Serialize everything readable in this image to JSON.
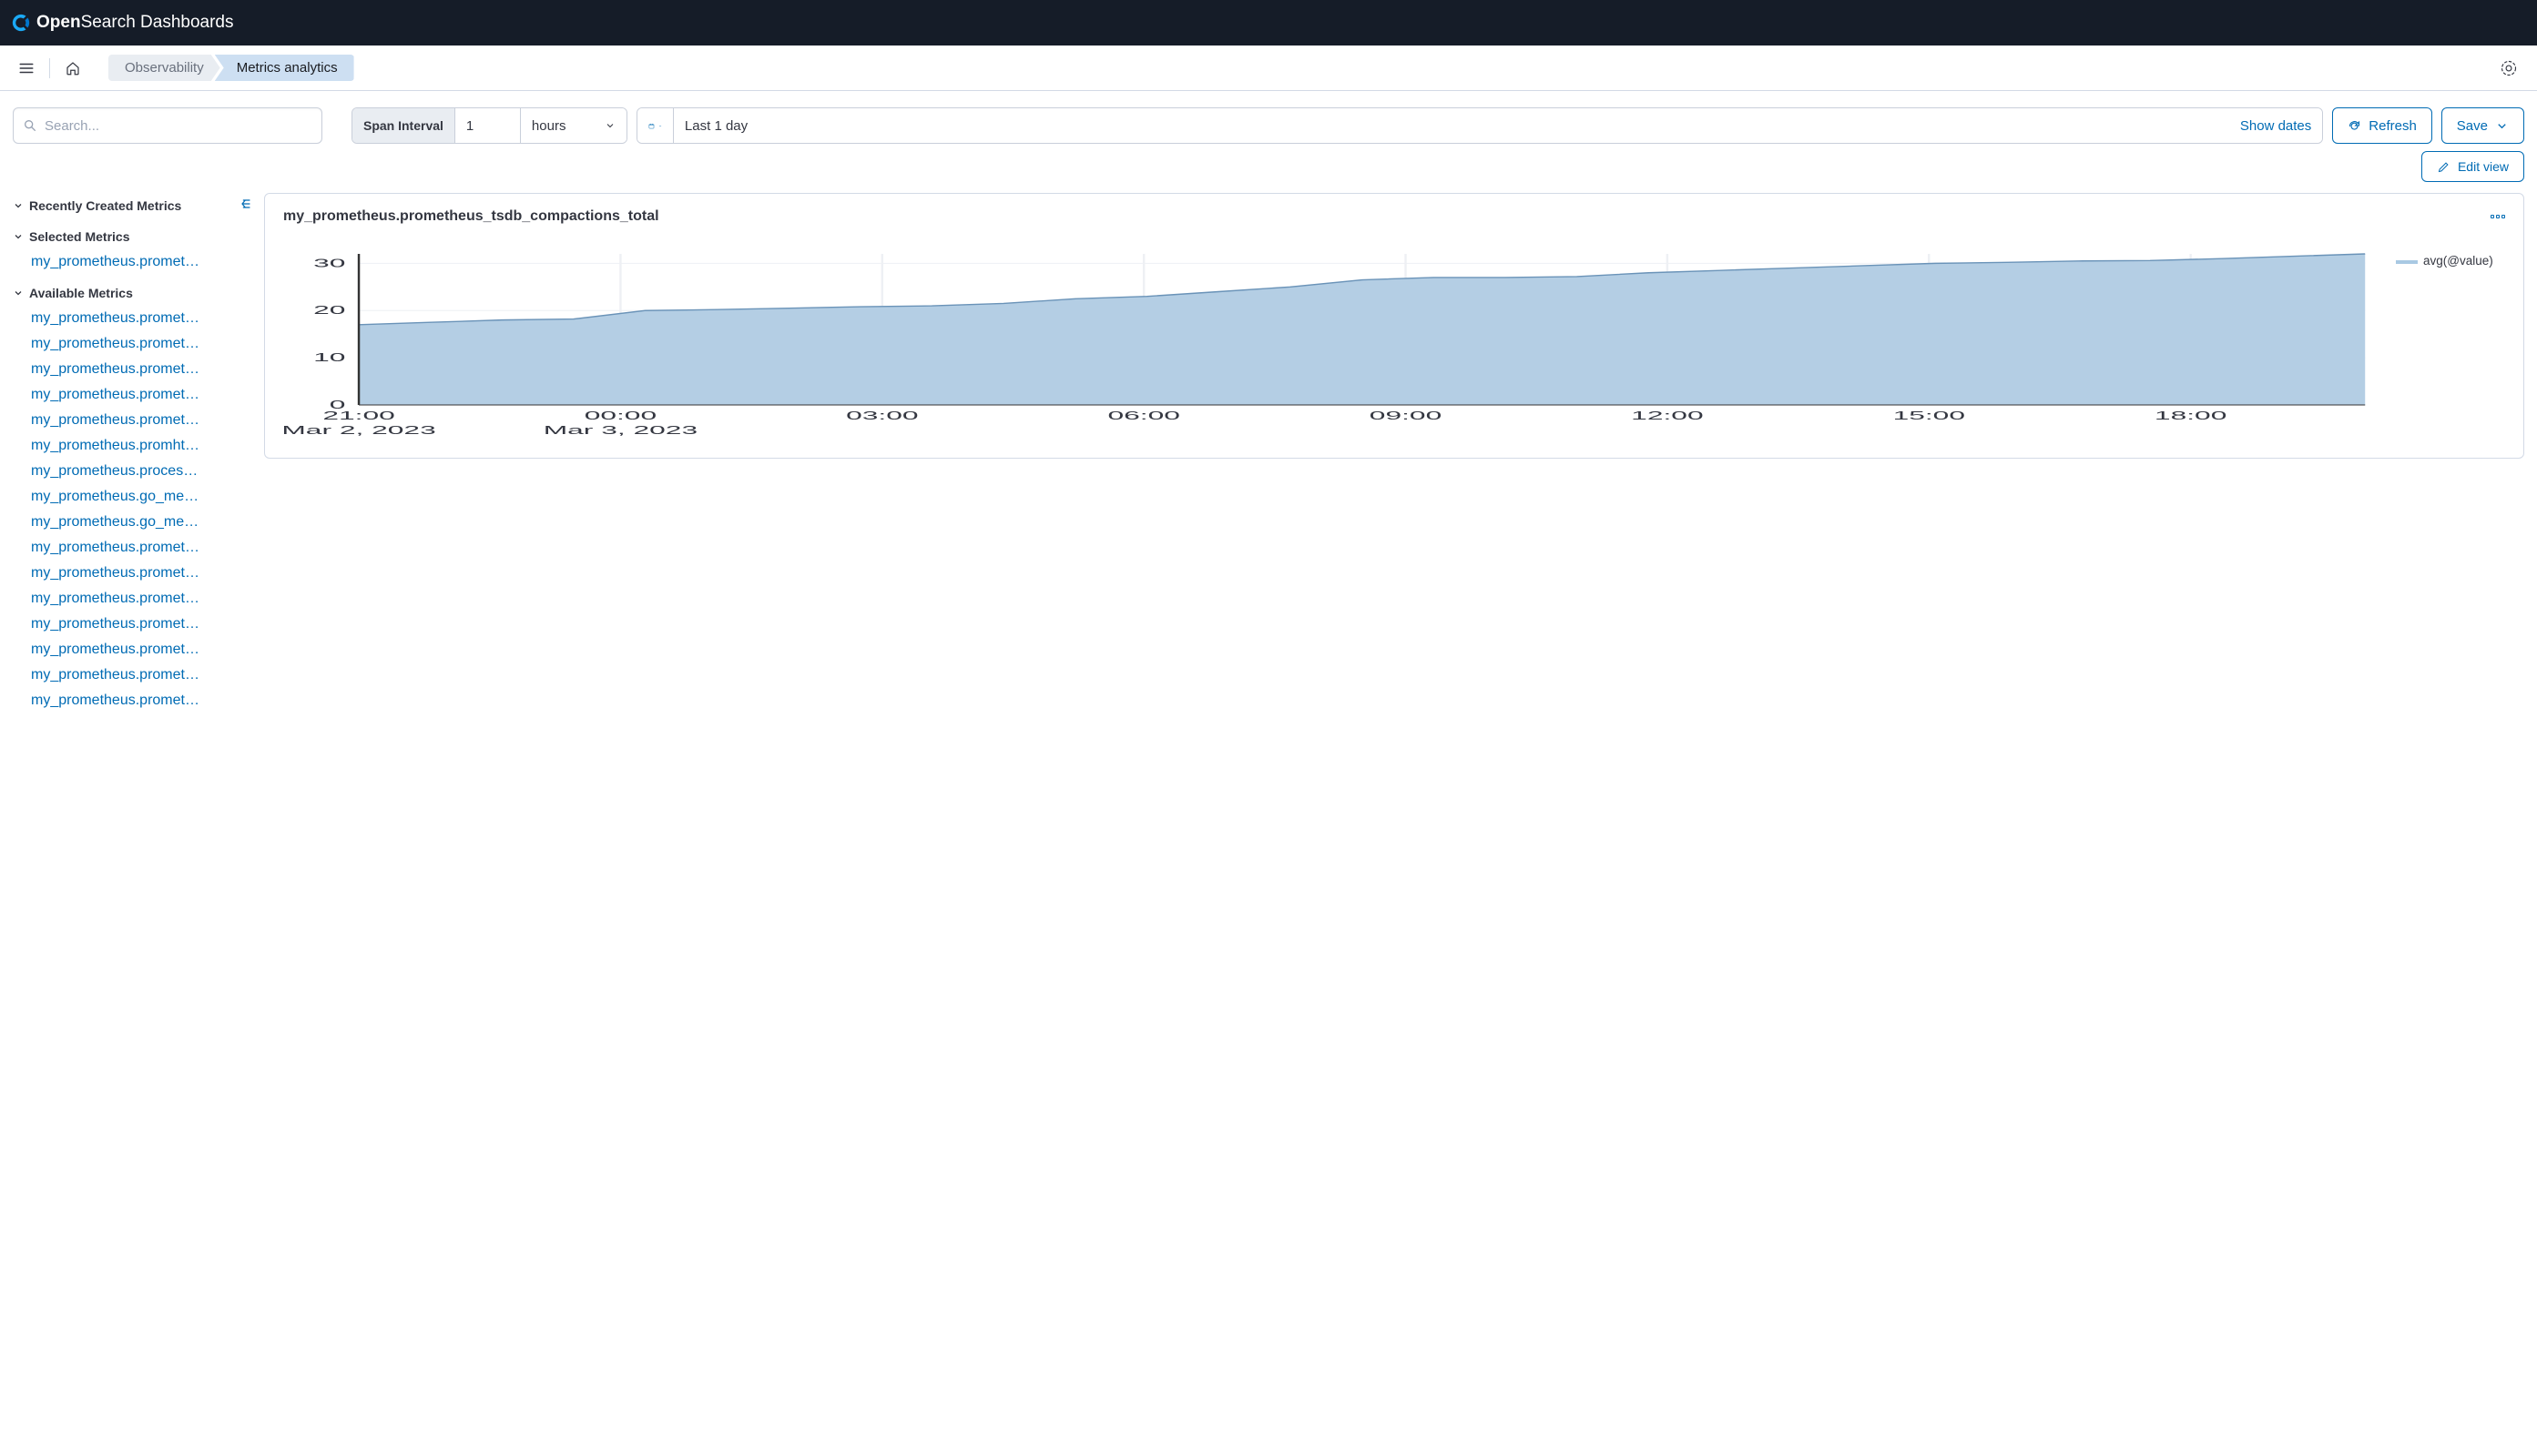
{
  "header": {
    "product_open": "Open",
    "product_search": "Search",
    "product_dash": "Dashboards"
  },
  "breadcrumb": {
    "observability": "Observability",
    "current": "Metrics analytics"
  },
  "toolbar": {
    "search_placeholder": "Search...",
    "span_label": "Span Interval",
    "span_value": "1",
    "span_unit": "hours",
    "date_label": "Last 1 day",
    "show_dates": "Show dates",
    "refresh": "Refresh",
    "save": "Save",
    "edit_view": "Edit view"
  },
  "sidebar": {
    "recent_label": "Recently Created Metrics",
    "selected_label": "Selected Metrics",
    "available_label": "Available Metrics",
    "selected": [
      "my_prometheus.promet…"
    ],
    "available": [
      "my_prometheus.promet…",
      "my_prometheus.promet…",
      "my_prometheus.promet…",
      "my_prometheus.promet…",
      "my_prometheus.promet…",
      "my_prometheus.promht…",
      "my_prometheus.proces…",
      "my_prometheus.go_me…",
      "my_prometheus.go_me…",
      "my_prometheus.promet…",
      "my_prometheus.promet…",
      "my_prometheus.promet…",
      "my_prometheus.promet…",
      "my_prometheus.promet…",
      "my_prometheus.promet…",
      "my_prometheus.promet…"
    ]
  },
  "panel": {
    "title": "my_prometheus.prometheus_tsdb_compactions_total",
    "legend": "avg(@value)"
  },
  "chart_data": {
    "type": "area",
    "title": "my_prometheus.prometheus_tsdb_compactions_total",
    "xlabel": "",
    "ylabel": "",
    "ylim": [
      0,
      32
    ],
    "y_ticks": [
      0,
      10,
      20,
      30
    ],
    "x_ticks": [
      "21:00",
      "00:00",
      "03:00",
      "06:00",
      "09:00",
      "12:00",
      "15:00",
      "18:00"
    ],
    "x_dates": {
      "21:00": "Mar 2, 2023",
      "00:00": "Mar 3, 2023"
    },
    "series": [
      {
        "name": "avg(@value)",
        "color": "#a9c9e3",
        "x": [
          "21:00",
          "22:00",
          "23:00",
          "00:00",
          "01:00",
          "02:00",
          "03:00",
          "04:00",
          "05:00",
          "06:00",
          "07:00",
          "08:00",
          "09:00",
          "10:00",
          "11:00",
          "12:00",
          "13:00",
          "14:00",
          "15:00",
          "16:00",
          "17:00",
          "18:00",
          "19:00",
          "20:00"
        ],
        "values": [
          17,
          17.5,
          18,
          18.2,
          20,
          20.2,
          20.5,
          20.8,
          21,
          21.5,
          22.5,
          23,
          24,
          25,
          26.5,
          27,
          27,
          27.2,
          28,
          28.5,
          29,
          29.5,
          30,
          30.2,
          30.5,
          30.6,
          31,
          31.5,
          32
        ]
      }
    ]
  }
}
